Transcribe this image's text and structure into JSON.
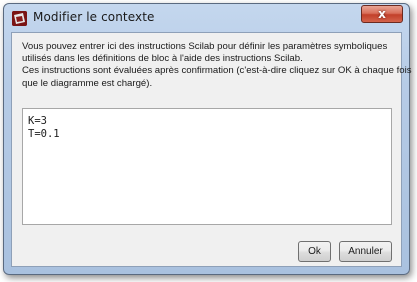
{
  "window": {
    "title": "Modifier le contexte",
    "close_label": "x",
    "app_icon": "scicos-icon"
  },
  "instructions": {
    "lines": [
      "Vous pouvez entrer ici des instructions Scilab pour définir les paramètres symboliques",
      "utilisés dans les définitions de bloc à l'aide des instructions Scilab.",
      "Ces instructions sont évaluées après confirmation (c'est-à-dire cliquez sur OK à chaque fois",
      "que le diagramme est chargé)."
    ]
  },
  "editor": {
    "content": "K=3\nT=0.1"
  },
  "buttons": {
    "ok_label": "Ok",
    "cancel_label": "Annuler"
  }
}
